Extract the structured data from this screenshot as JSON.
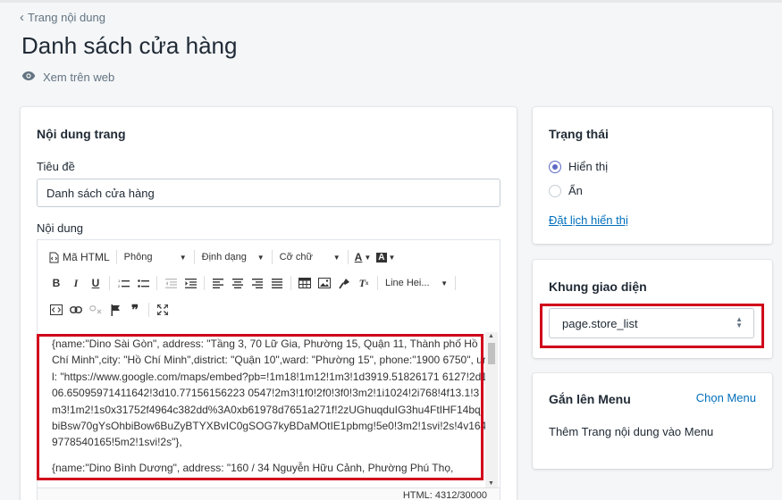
{
  "nav": {
    "back_label": "Trang nội dung"
  },
  "page": {
    "title": "Danh sách cửa hàng",
    "view_web": "Xem trên web"
  },
  "content_card": {
    "heading": "Nội dung trang",
    "title_label": "Tiêu đề",
    "title_value": "Danh sách cửa hàng",
    "content_label": "Nội dung"
  },
  "toolbar": {
    "html_label": "Mã HTML",
    "font_label": "Phông",
    "format_label": "Định dạng",
    "size_label": "Cỡ chữ",
    "line_height_label": "Line Hei..."
  },
  "editor": {
    "paragraphs": [
      "{name:\"Dino Sài Gòn\", address: \"Tầng 3, 70 Lữ Gia, Phường 15, Quận 11, Thành phố Hồ Chí Minh\",city: \"Hồ Chí Minh\",district: \"Quận 10\",ward: \"Phường 15\", phone:\"1900 6750\", url: \"https://www.google.com/maps/embed?pb=!1m18!1m12!1m3!1d3919.51826171 6127!2d106.65095971411642!3d10.77156156223 0547!2m3!1f0!2f0!3f0!3m2!1i1024!2i768!4f13.1!3m3!1m2!1s0x31752f4964c382dd%3A0xb61978d7651a271f!2zUGhuqduIG3hu4FtIHF14bqjbiBsw70gYsOhbiBow6BuZyBTYXBvIC0gSOG7kyBDaMOtIE1pbmg!5e0!3m2!1svi!2s!4v1649778540165!5m2!1svi!2s\"},",
      "{name:\"Dino Bình Dương\", address: \"160 / 34 Nguyễn Hữu Cảnh, Phường Phú Thọ,"
    ],
    "status": "HTML: 4312/30000"
  },
  "status_card": {
    "heading": "Trạng thái",
    "options": [
      "Hiển thị",
      "Ẩn"
    ],
    "selected": "Hiển thị",
    "schedule_link": "Đặt lịch hiển thị"
  },
  "template_card": {
    "heading": "Khung giao diện",
    "selected": "page.store_list"
  },
  "menu_card": {
    "heading": "Gắn lên Menu",
    "choose_link": "Chọn Menu",
    "description": "Thêm Trang nội dung vào Menu"
  },
  "colors": {
    "highlight": "#d0021b",
    "link": "#006fbb",
    "radio_accent": "#5c6ac4"
  }
}
